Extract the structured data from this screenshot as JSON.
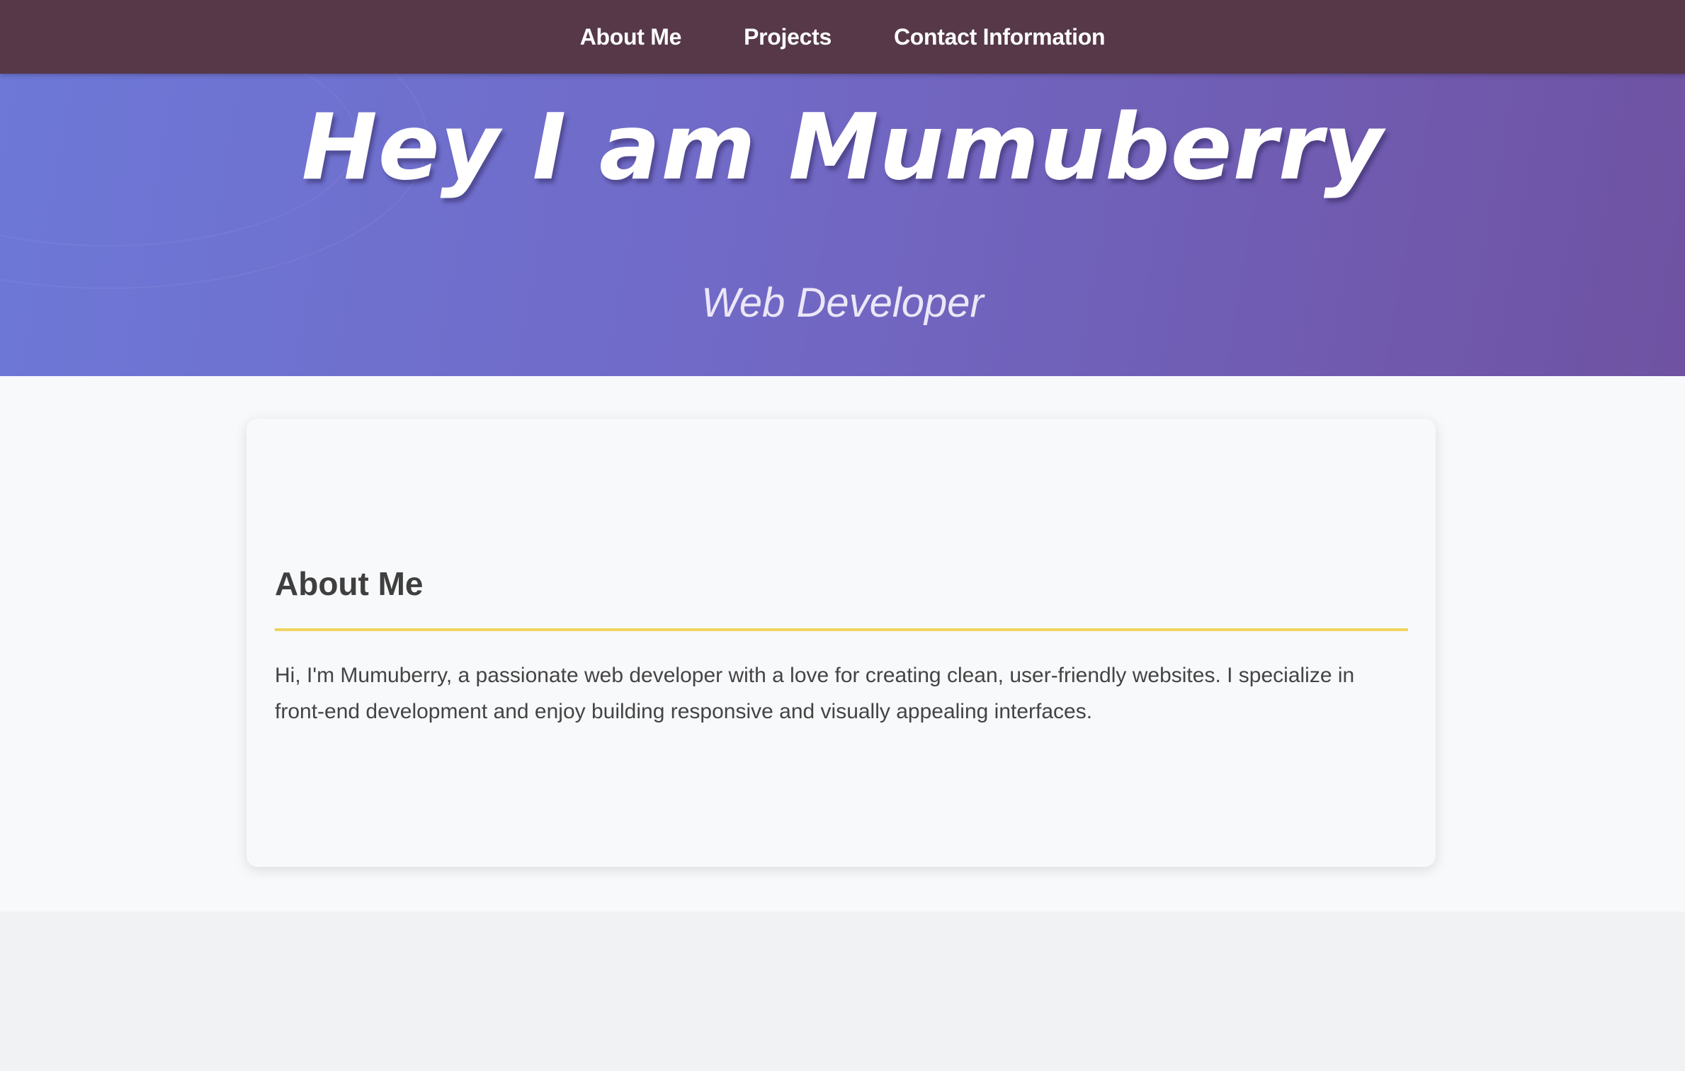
{
  "nav": {
    "items": [
      {
        "label": "About Me"
      },
      {
        "label": "Projects"
      },
      {
        "label": "Contact Information"
      }
    ]
  },
  "hero": {
    "title": "Hey I am Mumuberry",
    "subtitle": "Web Developer"
  },
  "about": {
    "heading": "About Me",
    "body": "Hi, I'm Mumuberry, a passionate web developer with a love for creating clean, user-friendly websites. I specialize in front-end development and enjoy building responsive and visually appealing interfaces."
  },
  "colors": {
    "nav_background": "#563848",
    "hero_gradient_start": "#6d78d7",
    "hero_gradient_end": "#6f52a2",
    "accent_divider": "#efd25e",
    "page_background": "#f8f9fb"
  }
}
